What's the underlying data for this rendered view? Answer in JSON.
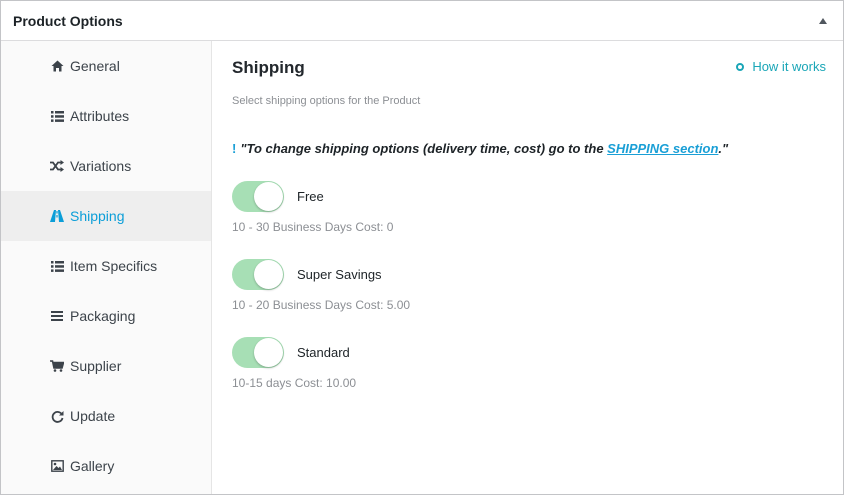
{
  "panel": {
    "title": "Product Options"
  },
  "sidebar": {
    "items": [
      {
        "label": "General",
        "icon": "home-icon"
      },
      {
        "label": "Attributes",
        "icon": "list-icon"
      },
      {
        "label": "Variations",
        "icon": "shuffle-icon"
      },
      {
        "label": "Shipping",
        "icon": "road-icon",
        "active": true
      },
      {
        "label": "Item Specifics",
        "icon": "list-icon"
      },
      {
        "label": "Packaging",
        "icon": "bars-icon"
      },
      {
        "label": "Supplier",
        "icon": "cart-icon"
      },
      {
        "label": "Update",
        "icon": "refresh-icon"
      },
      {
        "label": "Gallery",
        "icon": "image-icon"
      }
    ]
  },
  "main": {
    "title": "Shipping",
    "how_it_works": "How it works",
    "description": "Select shipping options for the Product",
    "notice": {
      "bang": "!",
      "prefix": "\"To change shipping options (delivery time, cost) go to the ",
      "link": "SHIPPING section",
      "suffix": ".\""
    },
    "options": [
      {
        "label": "Free",
        "meta": "10 - 30 Business Days Cost: 0",
        "enabled": true
      },
      {
        "label": "Super Savings",
        "meta": "10 - 20 Business Days Cost: 5.00",
        "enabled": true
      },
      {
        "label": "Standard",
        "meta": "10-15 days Cost: 10.00",
        "enabled": true
      }
    ]
  },
  "colors": {
    "accent": "#0b9ed8",
    "link": "#1aa6b7",
    "toggle_on": "#a7dfb5",
    "active_item_bg": "#eeeeee"
  }
}
